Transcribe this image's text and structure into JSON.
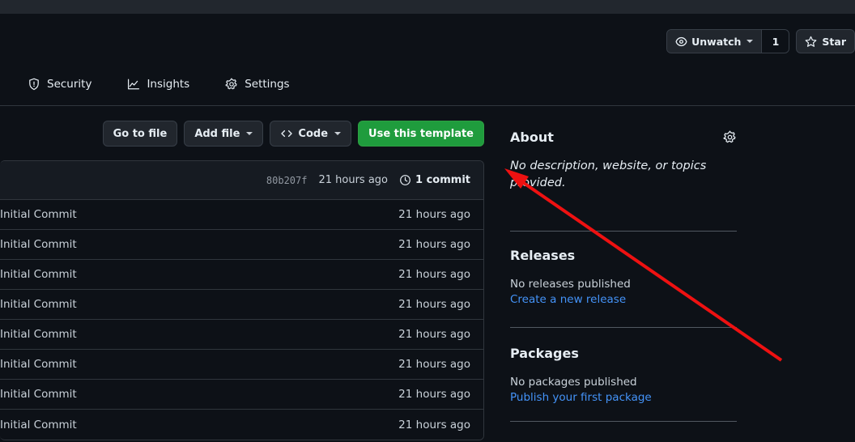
{
  "repo_actions": {
    "watch_label": "Unwatch",
    "watch_count": "1",
    "star_label": "Star",
    "eye_icon": "eye-icon",
    "star_icon": "star-icon",
    "caret_icon": "chevron-down-icon"
  },
  "nav": {
    "items": [
      {
        "label": "Security",
        "icon": "shield-icon"
      },
      {
        "label": "Insights",
        "icon": "graph-icon"
      },
      {
        "label": "Settings",
        "icon": "gear-icon"
      }
    ]
  },
  "file_actions": {
    "go_to_file": "Go to file",
    "add_file": "Add file",
    "code": "Code",
    "code_icon": "code-brackets-icon",
    "use_template": "Use this template",
    "primary_color": "#1f9c3d"
  },
  "commit_bar": {
    "sha": "80b207f",
    "when": "21 hours ago",
    "count_label": "1 commit",
    "history_icon": "clock-history-icon"
  },
  "files": [
    {
      "message": "Initial Commit",
      "when": "21 hours ago"
    },
    {
      "message": "Initial Commit",
      "when": "21 hours ago"
    },
    {
      "message": "Initial Commit",
      "when": "21 hours ago"
    },
    {
      "message": "Initial Commit",
      "when": "21 hours ago"
    },
    {
      "message": "Initial Commit",
      "when": "21 hours ago"
    },
    {
      "message": "Initial Commit",
      "when": "21 hours ago"
    },
    {
      "message": "Initial Commit",
      "when": "21 hours ago"
    },
    {
      "message": "Initial Commit",
      "when": "21 hours ago"
    }
  ],
  "sidebar": {
    "about": {
      "title": "About",
      "settings_icon": "gear-icon",
      "description": "No description, website, or topics provided."
    },
    "releases": {
      "title": "Releases",
      "empty": "No releases published",
      "link": "Create a new release"
    },
    "packages": {
      "title": "Packages",
      "empty": "No packages published",
      "link": "Publish your first package"
    }
  },
  "annotation": {
    "arrow_color": "#ee1111",
    "arrow_name": "red-pointer-arrow"
  }
}
